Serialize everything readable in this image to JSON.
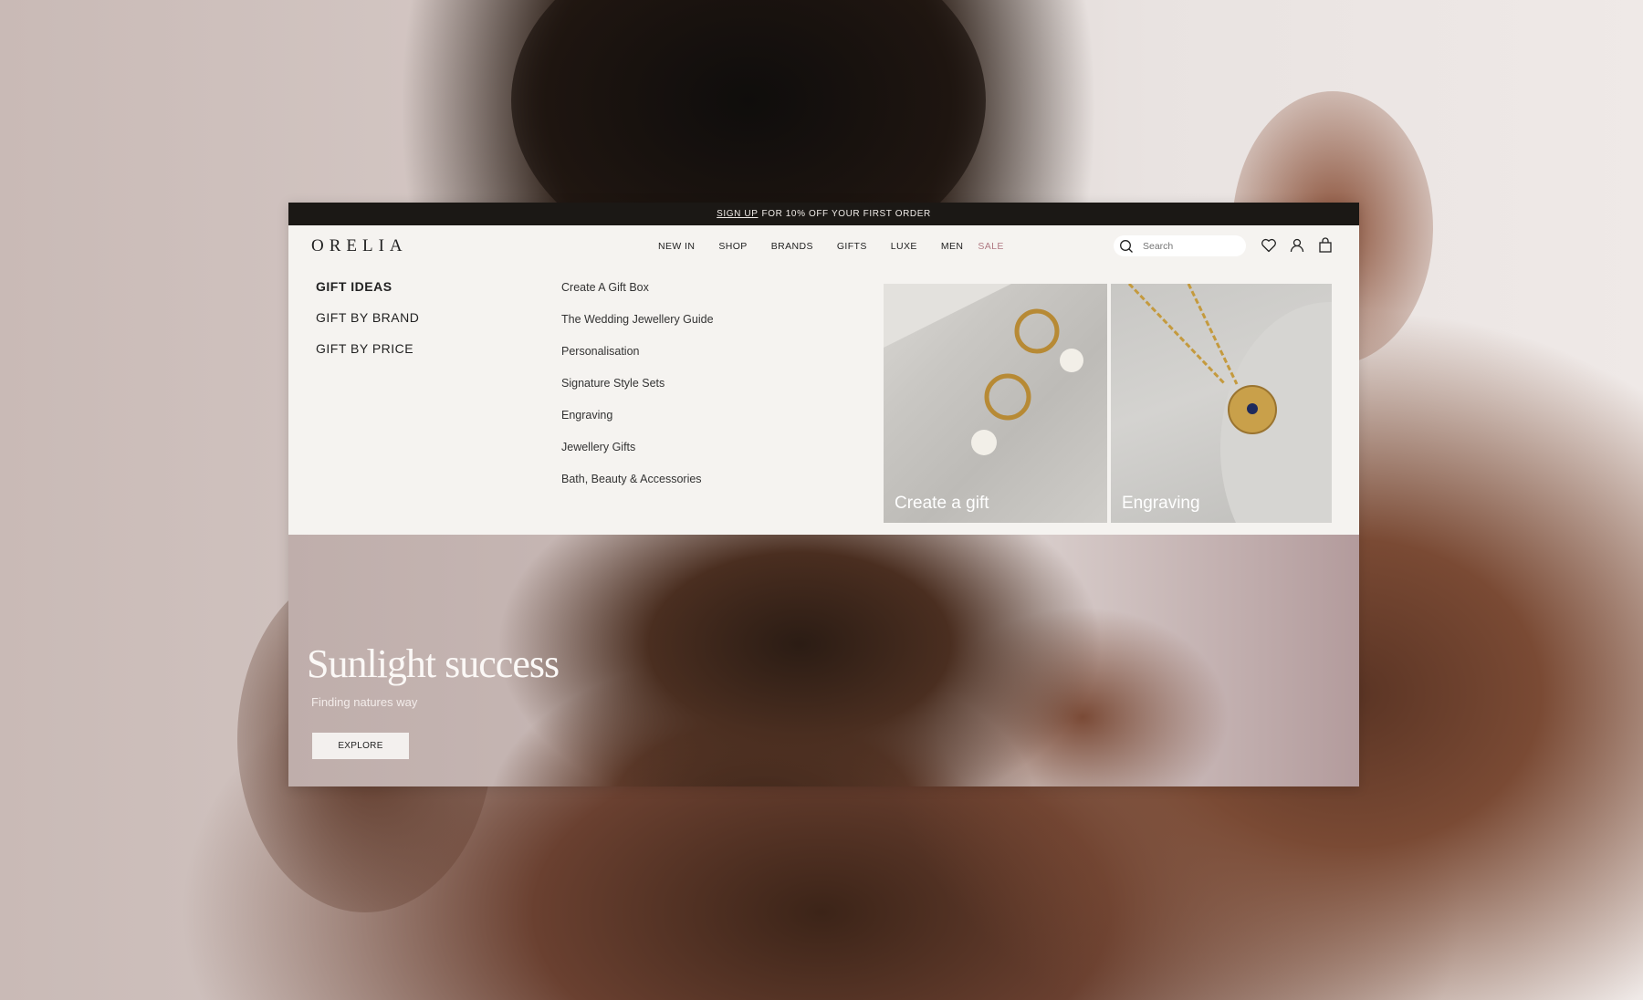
{
  "promo_bar": {
    "link": "SIGN UP",
    "text": "FOR 10% OFF YOUR FIRST ORDER"
  },
  "header": {
    "logo": "ORELIA",
    "nav": [
      {
        "label": "NEW IN"
      },
      {
        "label": "SHOP"
      },
      {
        "label": "BRANDS"
      },
      {
        "label": "GIFTS"
      },
      {
        "label": "LUXE"
      },
      {
        "label": "MEN"
      },
      {
        "label": "SALE",
        "color": "#b07a83"
      }
    ],
    "search": {
      "placeholder": "Search",
      "icon": "search-icon"
    },
    "icons": [
      "heart-icon",
      "user-icon",
      "shopping-bag-icon"
    ]
  },
  "mega_menu": {
    "categories": [
      {
        "label": "GIFT IDEAS",
        "active": true
      },
      {
        "label": "GIFT BY BRAND"
      },
      {
        "label": "GIFT BY PRICE"
      }
    ],
    "links": [
      "Create A Gift Box",
      "The Wedding Jewellery Guide",
      "Personalisation",
      "Signature Style Sets",
      "Engraving",
      "Jewellery Gifts",
      "Bath, Beauty & Accessories"
    ],
    "cards": [
      {
        "label": "Create a gift",
        "image": "gold hoop earrings with pearls on marble"
      },
      {
        "label": "Engraving",
        "image": "gold chain necklace with sapphire coin pendant on marble"
      }
    ]
  },
  "hero": {
    "headline": "Sunlight success",
    "subtitle": "Finding natures way",
    "button": "EXPLORE"
  },
  "colors": {
    "topbar": "#1b1815",
    "panel": "#f5f3f0",
    "sale": "#b07a83"
  }
}
